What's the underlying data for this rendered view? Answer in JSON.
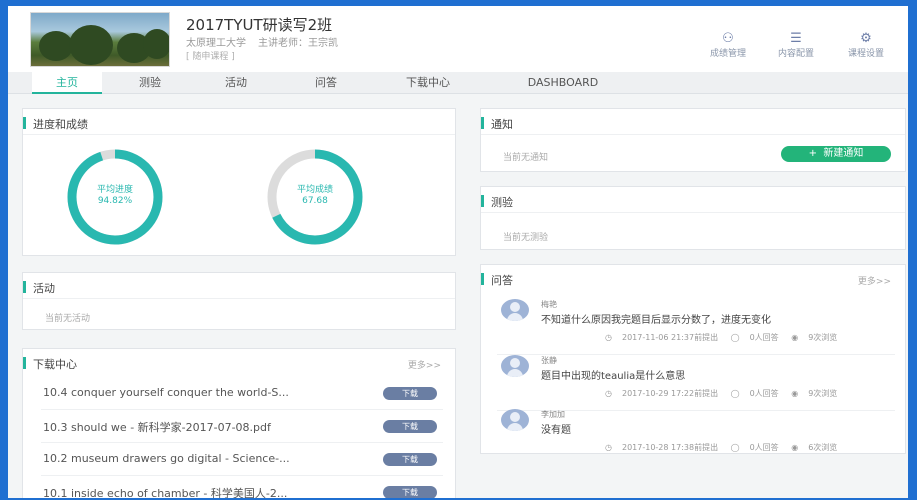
{
  "course": {
    "title": "2017TYUT研读写2班",
    "school": "太原理工大学",
    "teacher": "主讲老师：王宗凯",
    "follow": "[ 随申课程 ]"
  },
  "header_tools": [
    {
      "label": "成绩管理",
      "icon": "grade-icon"
    },
    {
      "label": "内容配置",
      "icon": "menu-icon"
    },
    {
      "label": "课程设置",
      "icon": "gear-icon"
    }
  ],
  "tabs": [
    "主页",
    "测验",
    "活动",
    "问答",
    "下载中心",
    "DASHBOARD"
  ],
  "progress": {
    "title": "进度和成绩",
    "rings": [
      {
        "label": "平均进度",
        "value": "94.82%",
        "fraction": 0.9482
      },
      {
        "label": "平均成绩",
        "value": "67.68",
        "fraction": 0.6768
      }
    ]
  },
  "activity": {
    "title": "活动",
    "empty": "当前无活动"
  },
  "downloads": {
    "title": "下载中心",
    "more": "更多>>",
    "button": "下载",
    "items": [
      "10.4 conquer yourself conquer the world-S...",
      "10.3 should we - 新科学家-2017-07-08.pdf",
      "10.2 museum drawers go digital - Science-...",
      "10.1 inside echo of chamber - 科学美国人-2..."
    ]
  },
  "notice": {
    "title": "通知",
    "empty": "当前无通知",
    "new_button": "新建通知"
  },
  "quiz": {
    "title": "测验",
    "empty": "当前无测验"
  },
  "qa": {
    "title": "问答",
    "more": "更多>>",
    "items": [
      {
        "user": "梅艳",
        "text": "不知道什么原因我完题目后显示分数了，进度无变化",
        "time": "2017-11-06 21:37前提出",
        "answers": "0人回答",
        "views": "9次浏览"
      },
      {
        "user": "张静",
        "text": "题目中出现的teaulia是什么意思",
        "time": "2017-10-29 17:22前提出",
        "answers": "0人回答",
        "views": "9次浏览"
      },
      {
        "user": "李加加",
        "text": "没有题",
        "time": "2017-10-28 17:38前提出",
        "answers": "0人回答",
        "views": "6次浏览"
      }
    ]
  },
  "colors": {
    "accent": "#23b49c",
    "ring": "#29b8b0",
    "frame": "#1f6fd1",
    "button": "#6a7ea3"
  }
}
